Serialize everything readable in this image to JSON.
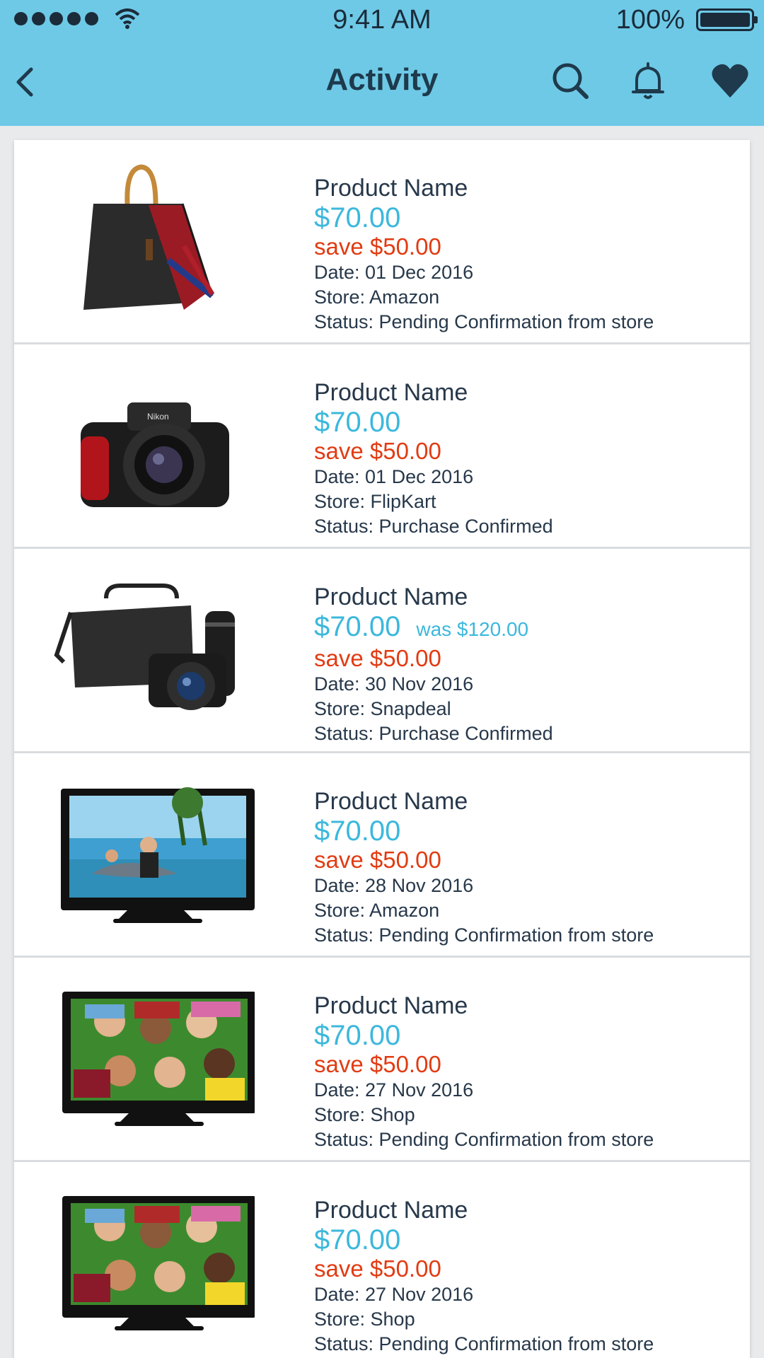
{
  "status_bar": {
    "time": "9:41 AM",
    "battery": "100%"
  },
  "header": {
    "title": "Activity"
  },
  "icons": {
    "back": "chevron-left-icon",
    "search": "search-icon",
    "notifications": "bell-icon",
    "favorites": "heart-icon",
    "signal": "signal-dots-icon",
    "wifi": "wifi-icon",
    "battery": "battery-icon"
  },
  "colors": {
    "header_bg": "#6ec9e6",
    "price": "#3cb8dc",
    "save": "#e23b12",
    "text": "#27384a"
  },
  "items": [
    {
      "name": "Product Name",
      "price": "$70.00",
      "was": "",
      "save": "save $50.00",
      "date": "Date: 01 Dec 2016",
      "store": "Store: Amazon",
      "status": "Status: Pending Confirmation from store",
      "image": "handbag"
    },
    {
      "name": "Product Name",
      "price": "$70.00",
      "was": "",
      "save": "save $50.00",
      "date": "Date: 01 Dec 2016",
      "store": "Store: FlipKart",
      "status": "Status: Purchase Confirmed",
      "image": "camera"
    },
    {
      "name": "Product Name",
      "price": "$70.00",
      "was": "was $120.00",
      "save": "save $50.00",
      "date": "Date: 30 Nov 2016",
      "store": "Store: Snapdeal",
      "status": "Status: Purchase Confirmed",
      "image": "camera-kit"
    },
    {
      "name": "Product Name",
      "price": "$70.00",
      "was": "",
      "save": "save $50.00",
      "date": "Date: 28 Nov 2016",
      "store": "Store: Amazon",
      "status": "Status: Pending Confirmation from store",
      "image": "tv-dolphin"
    },
    {
      "name": "Product Name",
      "price": "$70.00",
      "was": "",
      "save": "save $50.00",
      "date": "Date: 27 Nov 2016",
      "store": "Store: Shop",
      "status": "Status: Pending Confirmation from store",
      "image": "tv-kids"
    },
    {
      "name": "Product Name",
      "price": "$70.00",
      "was": "",
      "save": "save $50.00",
      "date": "Date: 27 Nov 2016",
      "store": "Store: Shop",
      "status": "Status: Pending Confirmation from store",
      "image": "tv-kids"
    }
  ]
}
